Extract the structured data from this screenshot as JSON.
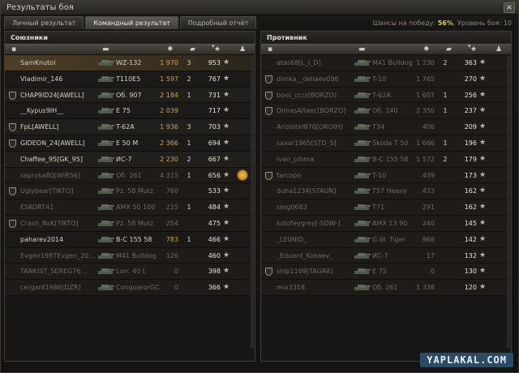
{
  "window": {
    "title": "Результаты боя",
    "close": "×"
  },
  "tabs": [
    {
      "label": "Личный результат"
    },
    {
      "label": "Командный результат"
    },
    {
      "label": "Подробный отчёт"
    }
  ],
  "chance": {
    "prefix": "Шансы на победу:",
    "value": "56%",
    "level_text": "Уровень боя: 10"
  },
  "columns": {
    "sort": "▾",
    "star": "★",
    "player": "♟"
  },
  "allies": {
    "title": "Союзники",
    "rows": [
      {
        "name": "SamKnutoi",
        "tank": "WZ-132",
        "damage": "1 970",
        "kills": "3",
        "xp": "953",
        "clan": false,
        "self": true,
        "dead": false,
        "medal": false
      },
      {
        "name": "Vladimir_146",
        "tank": "T110E5",
        "damage": "1 597",
        "kills": "2",
        "xp": "767",
        "clan": false,
        "self": false,
        "dead": false,
        "medal": false
      },
      {
        "name": "CHAP9lD24[AWELL]",
        "tank": "Об. 907",
        "damage": "2 184",
        "kills": "1",
        "xp": "731",
        "clan": true,
        "self": false,
        "dead": false,
        "medal": false
      },
      {
        "name": "__Kypus9IH__",
        "tank": "E 75",
        "damage": "2 039",
        "kills": "",
        "xp": "717",
        "clan": false,
        "self": false,
        "dead": false,
        "medal": false
      },
      {
        "name": "FpL[AWELL]",
        "tank": "T-62A",
        "damage": "1 936",
        "kills": "3",
        "xp": "703",
        "clan": true,
        "self": false,
        "dead": false,
        "medal": false
      },
      {
        "name": "GIDEON_24[AWELL]",
        "tank": "E 50 M",
        "damage": "2 366",
        "kills": "1",
        "xp": "694",
        "clan": true,
        "self": false,
        "dead": false,
        "medal": false
      },
      {
        "name": "Chaffee_95[GK_95]",
        "tank": "ИС-7",
        "damage": "2 230",
        "kills": "2",
        "xp": "667",
        "clan": false,
        "self": false,
        "dead": false,
        "medal": false
      },
      {
        "name": "sapryka80[WIR56]",
        "tank": "Об. 261",
        "damage": "4 315",
        "kills": "1",
        "xp": "656",
        "clan": false,
        "self": false,
        "dead": true,
        "medal": true
      },
      {
        "name": "Uglybear[TIKTO]",
        "tank": "Pz. 58 Mutz",
        "damage": "760",
        "kills": "",
        "xp": "533",
        "clan": true,
        "self": false,
        "dead": true,
        "medal": false
      },
      {
        "name": "ESKORT41",
        "tank": "AMX 50 100",
        "damage": "215",
        "kills": "1",
        "xp": "484",
        "clan": false,
        "self": false,
        "dead": true,
        "medal": false
      },
      {
        "name": "Crash_NsK[TIKTO]",
        "tank": "Pz. 58 Mutz",
        "damage": "254",
        "kills": "",
        "xp": "475",
        "clan": true,
        "self": false,
        "dead": true,
        "medal": false
      },
      {
        "name": "paharev2014",
        "tank": "B-C 155 58",
        "damage": "783",
        "kills": "1",
        "xp": "466",
        "clan": false,
        "self": false,
        "dead": false,
        "medal": false
      },
      {
        "name": "Evgen1987Evgen_20...",
        "tank": "M41 Bulldog",
        "damage": "126",
        "kills": "",
        "xp": "460",
        "clan": false,
        "self": false,
        "dead": true,
        "medal": false
      },
      {
        "name": "TANKIST_SEREG76...",
        "tank": "Lorr. 40 t",
        "damage": "0",
        "kills": "",
        "xp": "398",
        "clan": false,
        "self": false,
        "dead": true,
        "medal": false
      },
      {
        "name": "cergant1986[DZR]",
        "tank": "ConquerorGC",
        "damage": "0",
        "kills": "",
        "xp": "366",
        "clan": false,
        "self": false,
        "dead": true,
        "medal": false
      }
    ]
  },
  "enemies": {
    "title": "Противник",
    "rows": [
      {
        "name": "atas68[L_I_D]",
        "tank": "M41 Bulldog",
        "damage": "1 230",
        "kills": "2",
        "xp": "363",
        "clan": false,
        "dead": true
      },
      {
        "name": "dimka__deliaev096",
        "tank": "T-10",
        "damage": "1 765",
        "kills": "",
        "xp": "270",
        "clan": true,
        "dead": true
      },
      {
        "name": "boss_cccr[BORZO]",
        "tank": "T-62A",
        "damage": "1 607",
        "kills": "1",
        "xp": "256",
        "clan": true,
        "dead": true
      },
      {
        "name": "DimasAltaec[BORZO]",
        "tank": "Об. 140",
        "damage": "2 350",
        "kills": "1",
        "xp": "237",
        "clan": true,
        "dead": true
      },
      {
        "name": "Aristotel876[OROIH]",
        "tank": "T34",
        "damage": "406",
        "kills": "",
        "xp": "209",
        "clan": false,
        "dead": true
      },
      {
        "name": "saxar1965[STD_S]",
        "tank": "Škoda T 50",
        "damage": "1 666",
        "kills": "1",
        "xp": "196",
        "clan": false,
        "dead": true
      },
      {
        "name": "ivan_pihma",
        "tank": "B-C 155 58",
        "damage": "1 572",
        "kills": "2",
        "xp": "179",
        "clan": false,
        "dead": true
      },
      {
        "name": "farcopo",
        "tank": "T-10",
        "damage": "439",
        "kills": "",
        "xp": "173",
        "clan": true,
        "dead": true
      },
      {
        "name": "duha1234[STAUN]",
        "tank": "T57 Heavy",
        "damage": "433",
        "kills": "",
        "xp": "162",
        "clan": false,
        "dead": true
      },
      {
        "name": "serg0683",
        "tank": "T71",
        "damage": "291",
        "kills": "",
        "xp": "162",
        "clan": false,
        "dead": true
      },
      {
        "name": "kotofeygrey[-SDW-]",
        "tank": "AMX 13 90",
        "damage": "240",
        "kills": "",
        "xp": "145",
        "clan": false,
        "dead": true
      },
      {
        "name": "_LE0NID_",
        "tank": "G.W. Tiger",
        "damage": "968",
        "kills": "",
        "xp": "142",
        "clan": false,
        "dead": true
      },
      {
        "name": "_Eduard_Kokaev_",
        "tank": "ИС-7",
        "damage": "17",
        "kills": "",
        "xp": "132",
        "clan": false,
        "dead": true
      },
      {
        "name": "ship1109[TAGRA]",
        "tank": "E 75",
        "damage": "0",
        "kills": "",
        "xp": "130",
        "clan": true,
        "dead": true
      },
      {
        "name": "mix3318",
        "tank": "Об. 261",
        "damage": "1 338",
        "kills": "",
        "xp": "120",
        "clan": false,
        "dead": true
      }
    ]
  },
  "watermark": "YAPLAKAL.COM",
  "colors": {
    "accent": "#e8c94a",
    "damage": "#d2a553",
    "self_row": "#4d3e26"
  }
}
